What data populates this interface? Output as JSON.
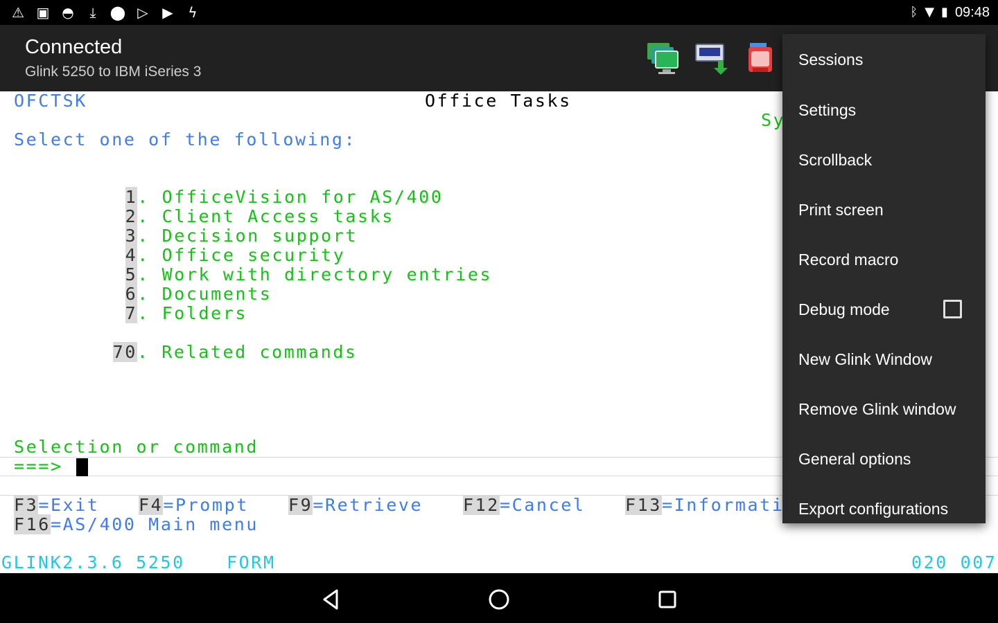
{
  "status_bar": {
    "left_icons": [
      "warning-icon",
      "image-icon",
      "android-icon",
      "download-icon",
      "location-icon",
      "play-store-icon",
      "play-icon",
      "flash-icon"
    ],
    "right_icons": [
      "bluetooth-icon",
      "wifi-icon",
      "battery-icon"
    ],
    "time": "09:48"
  },
  "action_bar": {
    "title": "Connected",
    "subtitle": "Glink 5250 to IBM iSeries 3",
    "actions": [
      "sessions-icon",
      "file-transfer-icon",
      "clipboard-icon"
    ]
  },
  "terminal": {
    "program": "OFCTSK",
    "screen_title": "Office Tasks",
    "system_fragment": "Sy",
    "prompt": "Select one of the following:",
    "options": [
      {
        "num": "1",
        "label": "OfficeVision for AS/400"
      },
      {
        "num": "2",
        "label": "Client Access tasks"
      },
      {
        "num": "3",
        "label": "Decision support"
      },
      {
        "num": "4",
        "label": "Office security"
      },
      {
        "num": "5",
        "label": "Work with directory entries"
      },
      {
        "num": "6",
        "label": "Documents"
      },
      {
        "num": "7",
        "label": "Folders"
      }
    ],
    "related": {
      "num": "70",
      "label": "Related commands"
    },
    "dot": ".",
    "selection_label": "Selection or command",
    "arrow": "===>",
    "fkeys_row1": [
      {
        "key": "F3",
        "label": "=Exit"
      },
      {
        "key": "F4",
        "label": "=Prompt"
      },
      {
        "key": "F9",
        "label": "=Retrieve"
      },
      {
        "key": "F12",
        "label": "=Cancel"
      },
      {
        "key": "F13",
        "label": "=Informati"
      }
    ],
    "fkeys_row2": [
      {
        "key": "F16",
        "label": "=AS/400 Main menu"
      }
    ],
    "status_left": "GLINK2.3.6 5250",
    "status_mode": "FORM",
    "status_pos": "020 007"
  },
  "menu": {
    "items": [
      "Sessions",
      "Settings",
      "Scrollback",
      "Print screen",
      "Record macro",
      "Debug mode",
      "New Glink Window",
      "Remove Glink window",
      "General options",
      "Export configurations"
    ],
    "debug_checked": false
  },
  "nav_bar": {
    "buttons": [
      "back-icon",
      "home-icon",
      "recents-icon"
    ]
  },
  "colors": {
    "terminal_blue": "#3d7cf2",
    "terminal_green": "#12c412",
    "terminal_cyan": "#20c8e6",
    "action_bar": "#212121",
    "menu": "#2b2b2b"
  }
}
